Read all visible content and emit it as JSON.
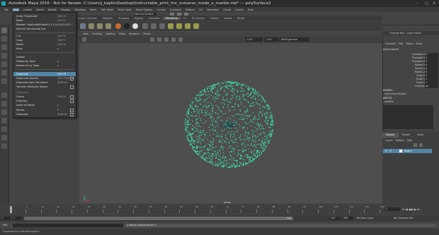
{
  "window": {
    "title": "Autodesk Maya 2016 - Not for Resale: C:\\Users\\j_kaplin\\Desktop\\Instructable_print_the_universe_inside_a_marble.mb* --- polySurface2"
  },
  "menubar": [
    "File",
    "Edit",
    "Create",
    "Select",
    "Modify",
    "Display",
    "Windows",
    "Mesh",
    "Edit Mesh",
    "Mesh Tools",
    "Mesh Display",
    "Curves",
    "Surfaces",
    "Deform",
    "UV",
    "Generate",
    "Cache",
    "Arnold",
    "Help"
  ],
  "shelf": {
    "tabs": [
      "Curves / Surfaces",
      "Polygons",
      "Sculpting",
      "Rigging",
      "Animation",
      "Rendering",
      "FX",
      "FX Caching",
      "Custom",
      "Arnold",
      "Bifrost",
      "MASH",
      "Motion Graphics",
      "XGen"
    ],
    "active": "Rendering",
    "workspace_label": "No Live Surface"
  },
  "edit_menu": {
    "items": [
      {
        "label": "Undo \"Duplicate\"",
        "shortcut": "Ctrl+Z"
      },
      {
        "label": "Redo",
        "shortcut": "Ctrl+Y"
      },
      {
        "label": "Repeat \"duplicatePreset(1,1,1,0,0,0,0,0,0,1,1,1,0,0,1,0,0,0,1)\"",
        "shortcut": ""
      },
      {
        "label": "Recent Commands List",
        "shortcut": ""
      },
      {
        "label": "Cut",
        "shortcut": "Ctrl+X"
      },
      {
        "label": "Copy",
        "shortcut": "Ctrl+C"
      },
      {
        "label": "Paste",
        "shortcut": "Ctrl+V"
      },
      {
        "label": "Keys",
        "shortcut": ""
      },
      {
        "label": "Delete",
        "shortcut": ""
      },
      {
        "label": "Delete by Type",
        "shortcut": ""
      },
      {
        "label": "Delete All by Type",
        "shortcut": ""
      },
      {
        "label": "Duplicate",
        "shortcut": "Ctrl+D"
      },
      {
        "label": "Duplicate Special",
        "shortcut": "Ctrl+Shift+D"
      },
      {
        "label": "Duplicate with Transform",
        "shortcut": "Shift+D"
      },
      {
        "label": "Transfer Attribute Values",
        "shortcut": ""
      },
      {
        "label": "Hierarchy",
        "shortcut": ""
      },
      {
        "label": "Group",
        "shortcut": "Ctrl+G"
      },
      {
        "label": "Ungroup",
        "shortcut": ""
      },
      {
        "label": "Level of Detail",
        "shortcut": ""
      },
      {
        "label": "Parent",
        "shortcut": "P"
      },
      {
        "label": "Unparent",
        "shortcut": "Shift+P"
      }
    ],
    "highlighted": "Duplicate"
  },
  "viewport": {
    "menus": [
      "View",
      "Shading",
      "Lighting",
      "Show",
      "Renderer",
      "Panels"
    ],
    "field1": "0.00",
    "field2": "1.00",
    "color_space": "sRGB gamma",
    "camera": "persp"
  },
  "channel_box": {
    "header": "Channel Box / Layer Editor",
    "tabs": [
      "Channels",
      "Edit",
      "Object",
      "Show"
    ],
    "object": "polySurface2",
    "attributes": [
      {
        "name": "Translate X",
        "value": "0"
      },
      {
        "name": "Translate Y",
        "value": "0"
      },
      {
        "name": "Translate Z",
        "value": "0"
      },
      {
        "name": "Rotate X",
        "value": "0"
      },
      {
        "name": "Rotate Y",
        "value": "0"
      },
      {
        "name": "Rotate Z",
        "value": "0"
      },
      {
        "name": "Scale X",
        "value": "1"
      },
      {
        "name": "Scale Y",
        "value": "1"
      },
      {
        "name": "Scale Z",
        "value": "1"
      },
      {
        "name": "Visibility",
        "value": "on"
      }
    ],
    "shapes_label": "SHAPES",
    "shape_name": "polySurfaceShape2",
    "inputs_label": "INPUTS",
    "input_name": "polyBoo"
  },
  "layer_editor": {
    "tabs": [
      "Display",
      "Render",
      "Anim"
    ],
    "active": "Display",
    "menu": [
      "Layers",
      "Options",
      "Help"
    ],
    "row": {
      "v": "V",
      "p": "P",
      "name": "layer1"
    }
  },
  "timeline": {
    "ticks": [
      "1",
      "5",
      "10",
      "15",
      "20",
      "25",
      "30",
      "35",
      "40",
      "45",
      "50",
      "55",
      "60",
      "65",
      "70",
      "75",
      "80",
      "85",
      "90",
      "95",
      "100",
      "105",
      "110",
      "115",
      "120"
    ],
    "current": "1",
    "start": "1",
    "end": "120",
    "range_start": "1",
    "range_end": "120",
    "anim_end": "200",
    "range_bar_label": "120",
    "no_anim_layer": "No Anim Layer",
    "no_char_set": "No Character Set"
  },
  "command_line": {
    "lang": "MEL",
    "result": "// Result: polySurface2 //"
  },
  "help_line": {
    "text": "Duplicate the selected objects"
  },
  "colors": {
    "points": "#3de0b0",
    "highlight": "#5285a6",
    "bg_view": "#4e4e4e"
  }
}
